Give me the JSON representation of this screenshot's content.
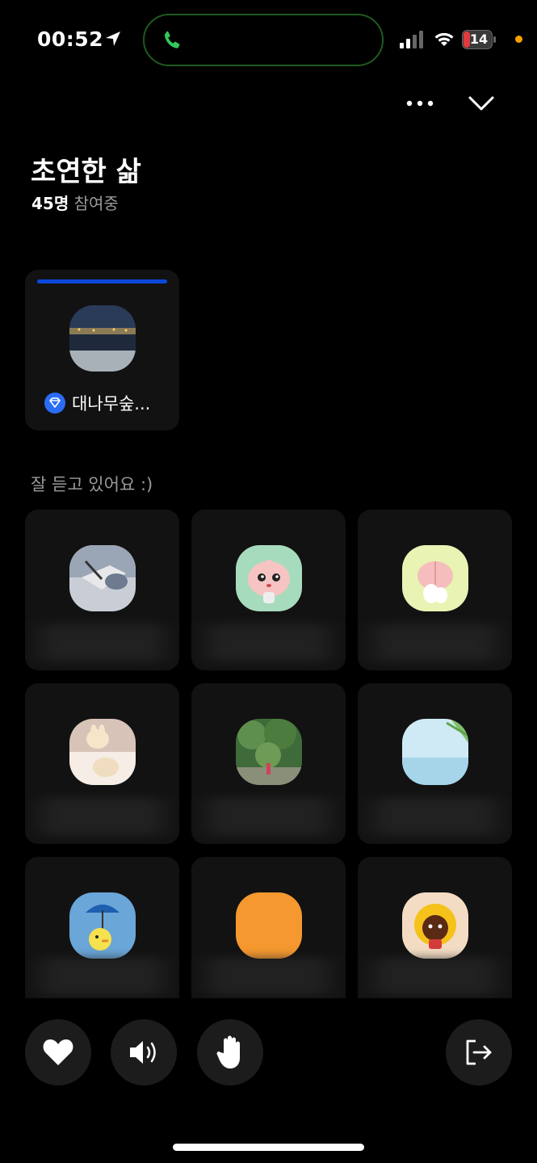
{
  "status_bar": {
    "time": "00:52",
    "battery": "14",
    "icons": [
      "location-arrow-icon",
      "phone-call-icon",
      "signal-icon",
      "wifi-icon",
      "battery-icon"
    ]
  },
  "header": {
    "more_icon": "more-horizontal-icon",
    "collapse_icon": "chevron-down-icon"
  },
  "room": {
    "title": "초연한 삶",
    "participant_count": "45명",
    "participant_status": "참여중"
  },
  "speaker": {
    "name": "대나무숲...",
    "badge_icon": "host-diamond-icon",
    "is_speaking": true
  },
  "listeners": {
    "section_label": "잘 듣고 있어요 :)",
    "avatars": [
      {
        "kind": "photo-writing"
      },
      {
        "kind": "peach-character"
      },
      {
        "kind": "peach-character-back"
      },
      {
        "kind": "rabbit-sticker"
      },
      {
        "kind": "garden-photo"
      },
      {
        "kind": "sky-sea-photo"
      },
      {
        "kind": "duck-umbrella"
      },
      {
        "kind": "orange-solid"
      },
      {
        "kind": "lion-afro"
      }
    ]
  },
  "controls": {
    "like": "heart-icon",
    "speaker": "speaker-icon",
    "raise_hand": "hand-icon",
    "leave": "leave-icon"
  },
  "colors": {
    "background": "#000000",
    "tile": "#121212",
    "speaking_bar": "#0a49d8",
    "recording_dot": "#f7a200"
  }
}
